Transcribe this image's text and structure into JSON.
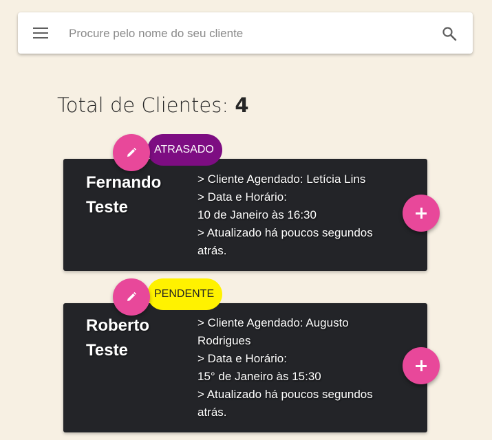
{
  "search": {
    "placeholder": "Procure pelo nome do seu cliente",
    "menu_icon": "menu-icon",
    "search_icon": "search-icon"
  },
  "summary": {
    "label": "Total de Clientes:",
    "count": "4"
  },
  "colors": {
    "background": "#f7f0e3",
    "card": "#232428",
    "accent": "#e8489a",
    "status_late": "#7d0d82",
    "status_pending": "#fff200"
  },
  "clients": [
    {
      "name_line1": "Fernando",
      "name_line2": "Teste",
      "status": "ATRASADO",
      "scheduled": "> Cliente Agendado: Letícia Lins",
      "date_label": "> Data e Horário:",
      "date_value": "10 de Janeiro às 16:30",
      "updated": "> Atualizado há poucos segundos atrás.",
      "edit_icon": "pencil-icon",
      "add_icon": "plus-icon"
    },
    {
      "name_line1": "Roberto",
      "name_line2": "Teste",
      "status": "PENDENTE",
      "scheduled": "> Cliente Agendado: Augusto Rodrigues",
      "date_label": "> Data e Horário:",
      "date_value": "15° de Janeiro às 15:30",
      "updated": "> Atualizado há poucos segundos atrás.",
      "edit_icon": "pencil-icon",
      "add_icon": "plus-icon"
    }
  ]
}
